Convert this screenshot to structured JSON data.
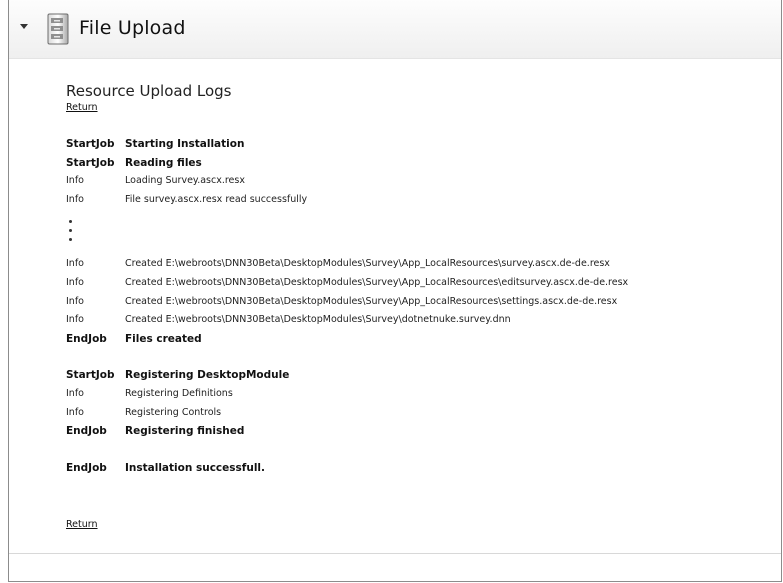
{
  "module": {
    "title": "File Upload",
    "icon": "file-cabinet-icon",
    "collapse_icon": "chevron-down-icon"
  },
  "content": {
    "heading": "Resource Upload Logs",
    "return_top": "Return",
    "return_bottom": "Return"
  },
  "log": [
    {
      "type": "StartJob",
      "message": "Starting Installation",
      "bold": true
    },
    {
      "type": "StartJob",
      "message": "Reading files",
      "bold": true
    },
    {
      "type": "Info",
      "message": "Loading Survey.ascx.resx",
      "bold": false
    },
    {
      "type": "Info",
      "message": "File survey.ascx.resx read successfully",
      "bold": false
    },
    {
      "type": "Info",
      "message": "Created E:\\webroots\\DNN30Beta\\DesktopModules\\Survey\\App_LocalResources\\survey.ascx.de-de.resx",
      "bold": false
    },
    {
      "type": "Info",
      "message": "Created E:\\webroots\\DNN30Beta\\DesktopModules\\Survey\\App_LocalResources\\editsurvey.ascx.de-de.resx",
      "bold": false
    },
    {
      "type": "Info",
      "message": "Created E:\\webroots\\DNN30Beta\\DesktopModules\\Survey\\App_LocalResources\\settings.ascx.de-de.resx",
      "bold": false
    },
    {
      "type": "Info",
      "message": "Created E:\\webroots\\DNN30Beta\\DesktopModules\\Survey\\dotnetnuke.survey.dnn",
      "bold": false
    },
    {
      "type": "EndJob",
      "message": "Files created",
      "bold": true
    },
    {
      "type": "StartJob",
      "message": "Registering DesktopModule",
      "bold": true
    },
    {
      "type": "Info",
      "message": "Registering Definitions",
      "bold": false
    },
    {
      "type": "Info",
      "message": "Registering Controls",
      "bold": false
    },
    {
      "type": "EndJob",
      "message": "Registering finished",
      "bold": true
    },
    {
      "type": "EndJob",
      "message": "Installation successfull.",
      "bold": true
    }
  ]
}
